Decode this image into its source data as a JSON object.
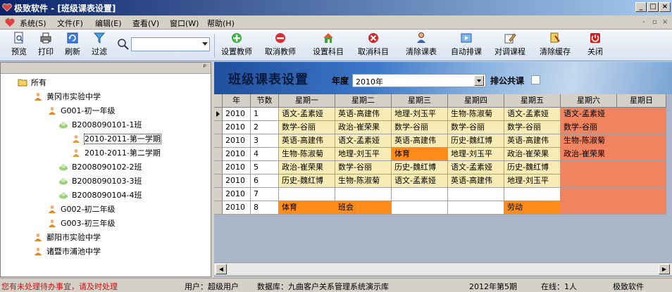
{
  "window": {
    "title": "极致软件 - [班级课表设置]",
    "buttons": [
      "_",
      "□",
      "×"
    ]
  },
  "menu": {
    "items": [
      "系统(S)",
      "文件(F)",
      "编辑(E)",
      "查看(V)",
      "窗口(W)",
      "帮助(H)"
    ],
    "mdi_controls": [
      "-",
      "▫",
      "×"
    ]
  },
  "toolbar": {
    "left_buttons": [
      "预览",
      "打印",
      "刷新",
      "过滤"
    ],
    "search_value": "",
    "right_buttons": [
      "设置教师",
      "取消教师",
      "设置科目",
      "取消科目",
      "清除课表",
      "自动排课",
      "对调课程",
      "清除缓存",
      "关闭"
    ]
  },
  "tree": {
    "pin": "ᵖ",
    "nodes": [
      {
        "label": "所有",
        "level": 0,
        "icon": "folder-icon"
      },
      {
        "label": "黄冈市实验中学",
        "level": 1,
        "icon": "school-icon"
      },
      {
        "label": "G001-初一年级",
        "level": 2,
        "icon": "grade-icon"
      },
      {
        "label": "B2008090101-1班",
        "level": 3,
        "icon": "class-icon"
      },
      {
        "label": "2010-2011-第一学期",
        "level": 4,
        "icon": "term-icon",
        "selected": true
      },
      {
        "label": "2010-2011-第二学期",
        "level": 4,
        "icon": "term-icon"
      },
      {
        "label": "B2008090102-2班",
        "level": 3,
        "icon": "class-icon"
      },
      {
        "label": "B2008090103-3班",
        "level": 3,
        "icon": "class-icon"
      },
      {
        "label": "B2008090104-4班",
        "level": 3,
        "icon": "class-icon"
      },
      {
        "label": "G002-初二年级",
        "level": 2,
        "icon": "grade-icon"
      },
      {
        "label": "G003-初三年级",
        "level": 2,
        "icon": "grade-icon"
      },
      {
        "label": "鄱阳市实验中学",
        "level": 1,
        "icon": "school-icon"
      },
      {
        "label": "诸暨市浦池中学",
        "level": 1,
        "icon": "school-icon"
      }
    ]
  },
  "panel": {
    "title": "班级课表设置",
    "year_label": "年度",
    "year_value": "2010年",
    "share_label": "排公共课",
    "share_checked": false
  },
  "grid": {
    "columns": [
      "年",
      "节数",
      "星期一",
      "星期二",
      "星期三",
      "星期四",
      "星期五",
      "星期六",
      "星期日"
    ],
    "rows": [
      {
        "year": "2010",
        "period": "1",
        "cells": [
          "语文-孟素娅",
          "英语-高建伟",
          "地理-刘玉平",
          "生物-陈淑菊",
          "语文-孟素娅",
          "语文-孟素娅",
          ""
        ]
      },
      {
        "year": "2010",
        "period": "2",
        "cells": [
          "数学-谷丽",
          "政治-崔荣果",
          "数学-谷丽",
          "数学-谷丽",
          "数学-谷丽",
          "数学-谷丽",
          ""
        ]
      },
      {
        "year": "2010",
        "period": "3",
        "cells": [
          "英语-高建伟",
          "语文-孟素娅",
          "英语-高建伟",
          "历史-魏红博",
          "英语-高建伟",
          "生物-陈淑菊",
          ""
        ]
      },
      {
        "year": "2010",
        "period": "4",
        "cells": [
          "生物-陈淑菊",
          "地理-刘玉平",
          "体育",
          "地理-刘玉平",
          "政治-崔荣果",
          "政治-崔荣果",
          ""
        ]
      },
      {
        "year": "2010",
        "period": "5",
        "cells": [
          "政治-崔荣果",
          "数学-谷丽",
          "历史-魏红博",
          "语文-孟素娅",
          "历史-魏红博",
          "",
          ""
        ]
      },
      {
        "year": "2010",
        "period": "6",
        "cells": [
          "历史-魏红博",
          "生物-陈淑菊",
          "语文-孟素娅",
          "英语-高建伟",
          "地理-刘玉平",
          "",
          ""
        ]
      },
      {
        "year": "2010",
        "period": "7",
        "cells": [
          "",
          "",
          "",
          "",
          "",
          "",
          ""
        ]
      },
      {
        "year": "2010",
        "period": "8",
        "cells": [
          "体育",
          "班会",
          "",
          "",
          "劳动",
          "",
          ""
        ]
      }
    ],
    "cell_colors": [
      [
        "y",
        "y",
        "y",
        "y",
        "y",
        "s",
        "s"
      ],
      [
        "y",
        "y",
        "y",
        "y",
        "y",
        "s",
        "s"
      ],
      [
        "y",
        "y",
        "y",
        "y",
        "y",
        "s",
        "s"
      ],
      [
        "y",
        "y",
        "o",
        "y",
        "y",
        "s",
        "s"
      ],
      [
        "y",
        "y",
        "y",
        "y",
        "y",
        "s",
        "s"
      ],
      [
        "y",
        "y",
        "y",
        "y",
        "y",
        "s",
        "s"
      ],
      [
        "w",
        "w",
        "w",
        "w",
        "w",
        "s",
        "s"
      ],
      [
        "o",
        "o",
        "w",
        "w",
        "o",
        "s",
        "s"
      ]
    ],
    "colors": {
      "y": "#f7ecb5",
      "o": "#ff8c1a",
      "s": "#f08460",
      "w": "#ffffff"
    }
  },
  "status": {
    "alert": "您有未处理待办事宜，请及时处理",
    "user": "用户：超级用户",
    "database": "数据库：九曲客户关系管理系统演示库",
    "week": "2012年第5期",
    "online": "在线：1人",
    "brand": "极致软件"
  }
}
